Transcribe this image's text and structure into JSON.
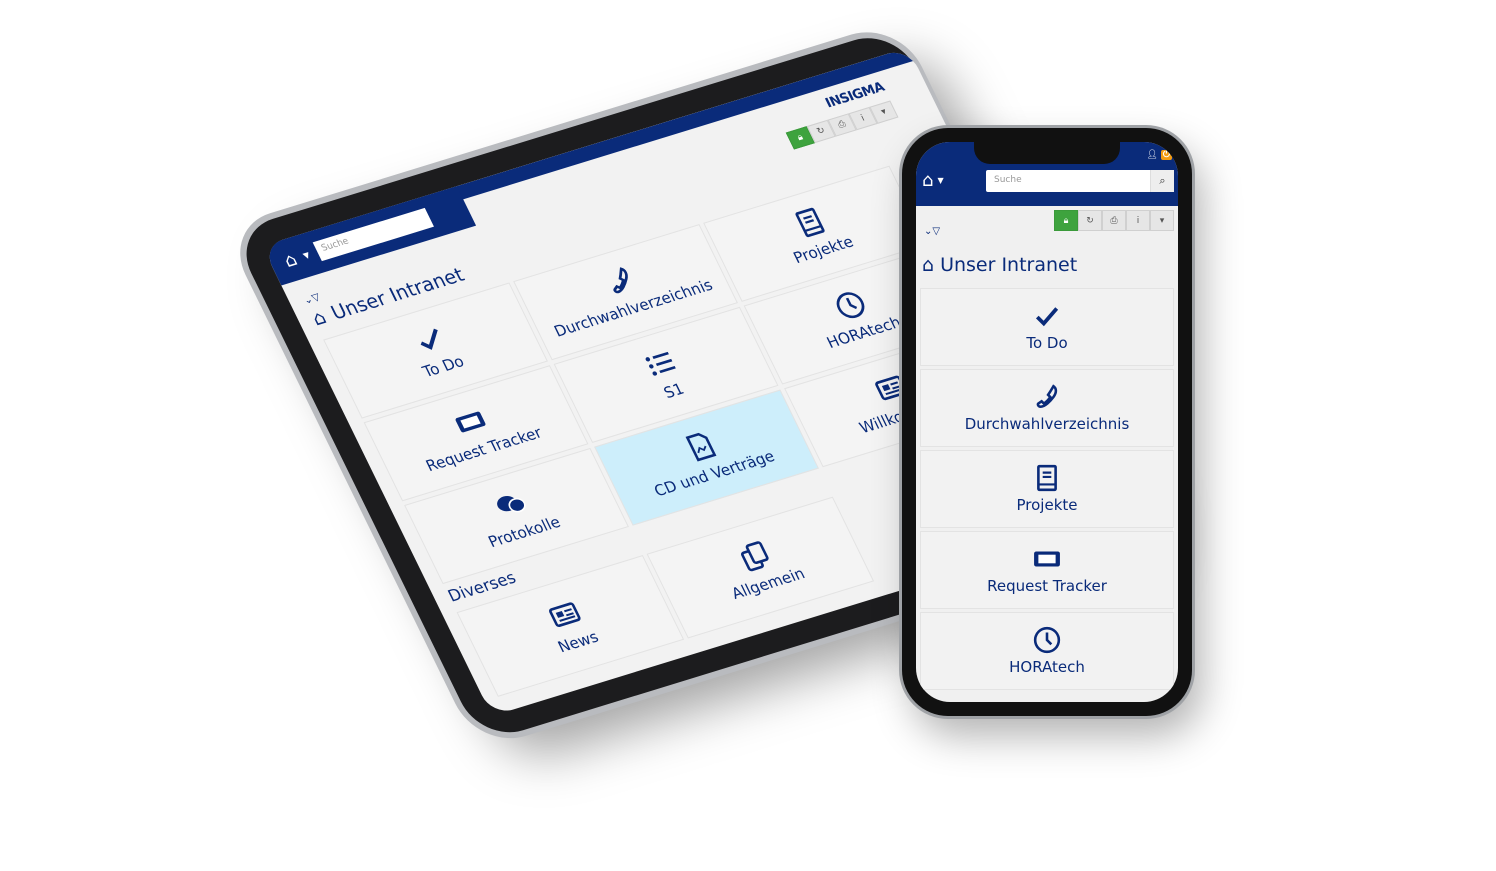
{
  "brand": {
    "logo": "INSIGMA",
    "accent": "#0a2b7a",
    "highlight": "#cdeefb",
    "green": "#3ea33e"
  },
  "search": {
    "placeholder": "Suche"
  },
  "toolbar": {
    "icons": [
      "lock-icon",
      "refresh-icon",
      "print-icon",
      "info-icon",
      "chevron-down-icon"
    ]
  },
  "page": {
    "title": "Unser Intranet",
    "section": "Diverses"
  },
  "tablet": {
    "tiles": [
      {
        "label": "To Do",
        "icon": "check"
      },
      {
        "label": "Durchwahlverzeichnis",
        "icon": "phone"
      },
      {
        "label": "Projekte",
        "icon": "book"
      },
      {
        "label": "Request Tracker",
        "icon": "ticket"
      },
      {
        "label": "S1",
        "icon": "list"
      },
      {
        "label": "HORAtech",
        "icon": "clock"
      },
      {
        "label": "Protokolle",
        "icon": "comments"
      },
      {
        "label": "CD und Verträge",
        "icon": "contract",
        "selected": true
      },
      {
        "label": "Willkommen",
        "icon": "newspaper"
      }
    ],
    "diverses": [
      {
        "label": "News",
        "icon": "newspaper"
      },
      {
        "label": "Allgemein",
        "icon": "copy"
      }
    ]
  },
  "phone": {
    "tiles": [
      {
        "label": "To Do",
        "icon": "check"
      },
      {
        "label": "Durchwahlverzeichnis",
        "icon": "phone"
      },
      {
        "label": "Projekte",
        "icon": "book"
      },
      {
        "label": "Request Tracker",
        "icon": "ticket"
      },
      {
        "label": "HORAtech",
        "icon": "clock"
      }
    ]
  }
}
